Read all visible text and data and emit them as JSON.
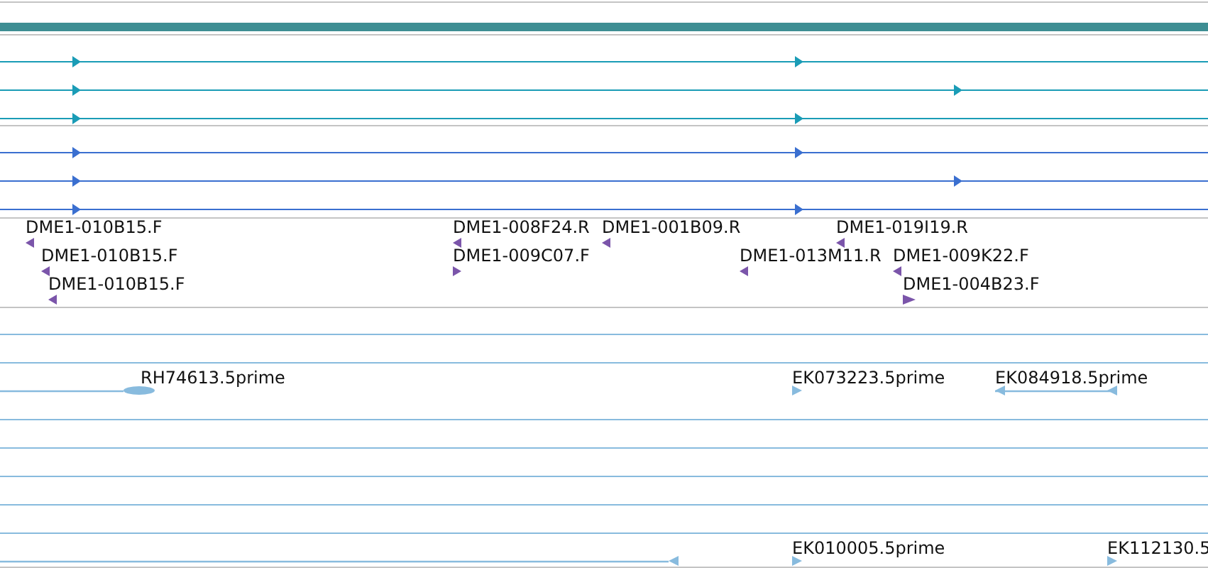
{
  "tracks": [
    {
      "kind": "lines",
      "color": "#1a9cb6",
      "rows": [
        {
          "markers": [
            {
              "reverse": false
            },
            {
              "reverse": false
            }
          ]
        },
        {
          "markers": [
            {
              "reverse": false
            },
            {
              "reverse": false
            }
          ]
        },
        {
          "markers": [
            {
              "reverse": false
            },
            {
              "reverse": false
            }
          ]
        }
      ]
    },
    {
      "kind": "lines",
      "color": "#3a6fd0",
      "rows": [
        {
          "markers": [
            {
              "reverse": false
            },
            {
              "reverse": false
            }
          ]
        },
        {
          "markers": [
            {
              "reverse": false
            },
            {
              "reverse": false
            }
          ]
        },
        {
          "markers": [
            {
              "reverse": false
            },
            {
              "reverse": false
            }
          ]
        }
      ]
    },
    {
      "kind": "labels",
      "color": "#7b55aa",
      "rows": [
        {
          "features": [
            {
              "label": "DME1-010B15.F",
              "reverse": true
            },
            {
              "label": "DME1-008F24.R",
              "reverse": true
            },
            {
              "label": "DME1-001B09.R",
              "reverse": true
            },
            {
              "label": "DME1-019I19.R",
              "reverse": true
            }
          ]
        },
        {
          "features": [
            {
              "label": "DME1-010B15.F",
              "reverse": true
            },
            {
              "label": "DME1-009C07.F",
              "reverse": false
            },
            {
              "label": "DME1-013M11.R",
              "reverse": true
            },
            {
              "label": "DME1-009K22.F",
              "reverse": true
            }
          ]
        },
        {
          "features": [
            {
              "label": "DME1-010B15.F",
              "reverse": true
            },
            {
              "label": "DME1-004B23.F",
              "reverse": false
            }
          ]
        }
      ]
    },
    {
      "kind": "est",
      "color": "#88bbde",
      "rows": [
        {
          "features": [
            {
              "label": "RH74613.5prime",
              "kind": "oval"
            },
            {
              "label": "EK073223.5prime",
              "kind": "arrow",
              "reverse": false
            },
            {
              "label": "EK084918.5prime",
              "kind": "arrow",
              "reverse": true
            }
          ]
        },
        {
          "features": [
            {
              "kind": "arrow",
              "reverse": true
            },
            {
              "label": "EK010005.5prime",
              "kind": "arrow",
              "reverse": false
            },
            {
              "label": "EK112130.5",
              "kind": "arrow",
              "reverse": false
            }
          ]
        }
      ]
    }
  ]
}
